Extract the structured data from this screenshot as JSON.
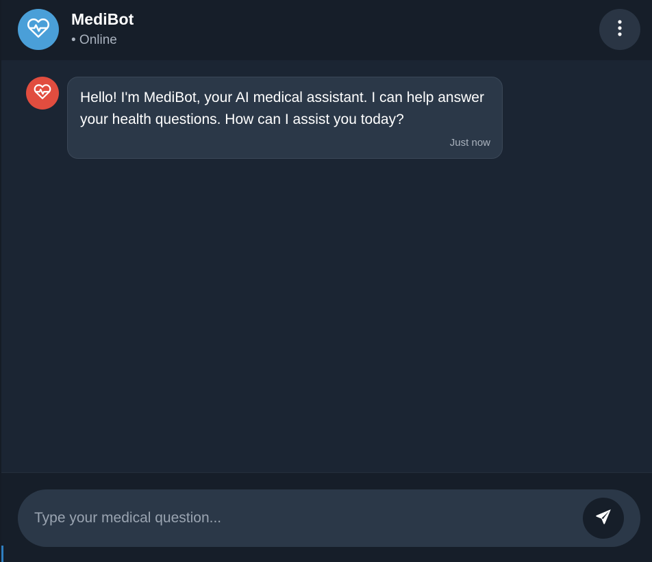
{
  "header": {
    "title": "MediBot",
    "status": "• Online",
    "avatar_icon": "heart-pulse-icon",
    "avatar_color": "#4a9fd8",
    "menu_icon": "more-vertical-icon"
  },
  "messages": [
    {
      "sender": "bot",
      "avatar_icon": "heart-pulse-icon",
      "avatar_color": "#e14d3f",
      "text": "Hello! I'm MediBot, your AI medical assistant. I can help answer your health questions. How can I assist you today?",
      "time": "Just now"
    }
  ],
  "composer": {
    "placeholder": "Type your medical question...",
    "value": "",
    "send_icon": "send-icon"
  },
  "colors": {
    "background": "#1b2533",
    "header": "#161e29",
    "bubble": "#2b3848",
    "accent": "#4a9fd8"
  }
}
